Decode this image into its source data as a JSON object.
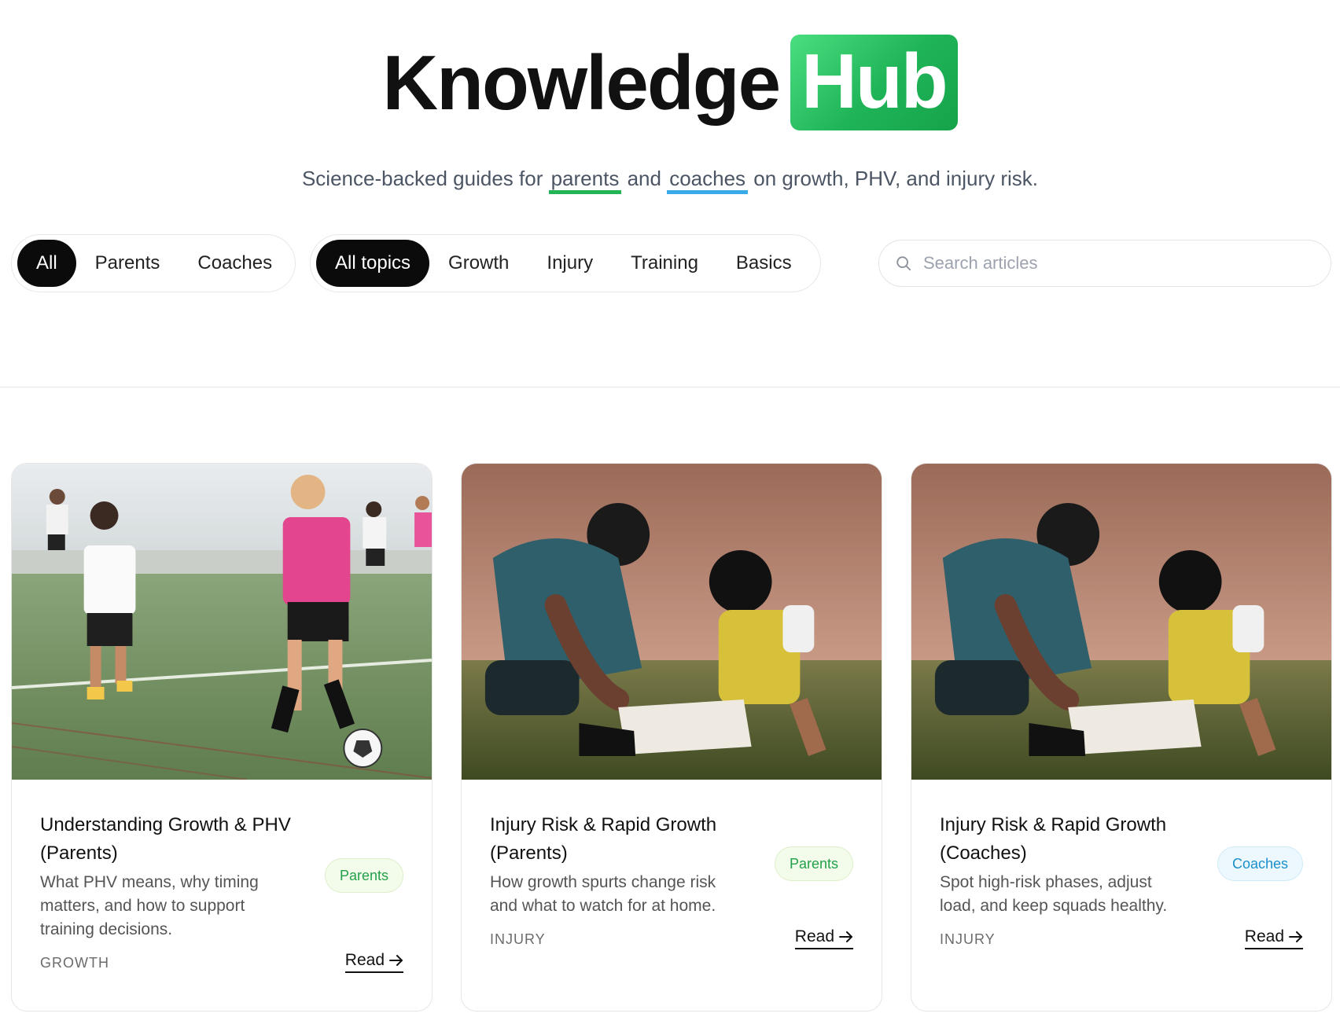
{
  "header": {
    "title_word": "Knowledge",
    "title_highlight": "Hub",
    "subtitle_prefix": "Science-backed guides for",
    "subtitle_parents": "parents",
    "subtitle_and": "and",
    "subtitle_coaches": "coaches",
    "subtitle_suffix": "on growth, PHV, and injury risk."
  },
  "filters": {
    "audience": [
      "All",
      "Parents",
      "Coaches"
    ],
    "audience_active": "All",
    "topics": [
      "All topics",
      "Growth",
      "Injury",
      "Training",
      "Basics"
    ],
    "topics_active": "All topics"
  },
  "search": {
    "placeholder": "Search articles",
    "value": ""
  },
  "cards": [
    {
      "title": "Understanding Growth & PHV (Parents)",
      "description": "What PHV means, why timing matters, and how to support training decisions.",
      "audience_badge": "Parents",
      "category": "GROWTH",
      "read_label": "Read"
    },
    {
      "title": "Injury Risk & Rapid Growth (Parents)",
      "description": "How growth spurts change risk and what to watch for at home.",
      "audience_badge": "Parents",
      "category": "INJURY",
      "read_label": "Read"
    },
    {
      "title": "Injury Risk & Rapid Growth (Coaches)",
      "description": "Spot high-risk phases, adjust load, and keep squads healthy.",
      "audience_badge": "Coaches",
      "category": "INJURY",
      "read_label": "Read"
    }
  ],
  "colors": {
    "brand_green": "#22b455",
    "accent_blue": "#3aa9e8",
    "active_pill": "#0b0b0b"
  },
  "icons": {
    "search": "magnifier-icon",
    "read_arrow": "arrow-right-icon"
  }
}
